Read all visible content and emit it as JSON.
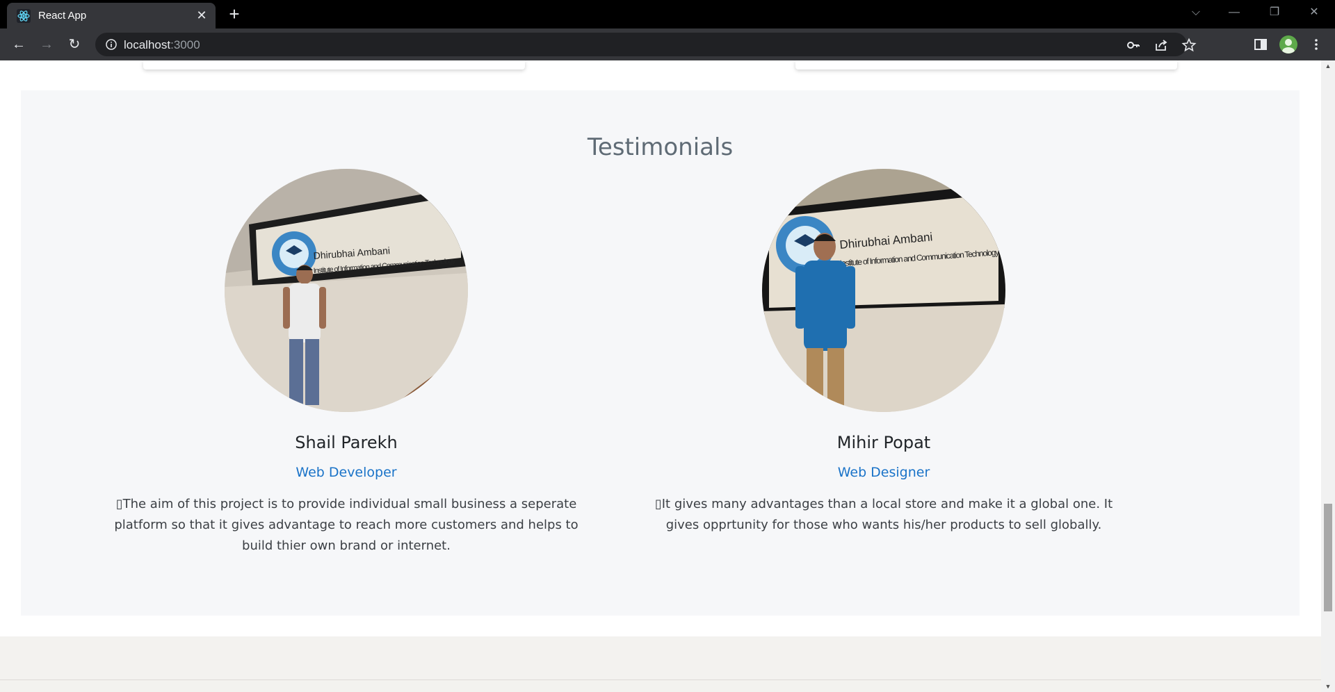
{
  "browser": {
    "tab_title": "React App",
    "tab_close": "✕",
    "new_tab": "+",
    "url_host": "localhost",
    "url_port": ":3000",
    "window_controls": {
      "tabs_menu": "⌵",
      "minimize": "—",
      "restore": "❐",
      "close": "✕"
    },
    "nav": {
      "back": "←",
      "forward": "→",
      "reload": "↻"
    },
    "icons": {
      "favicon": "react-icon",
      "info": "info-icon",
      "key": "key-icon",
      "share": "share-icon",
      "star": "star-icon",
      "sidepanel": "side-panel-icon",
      "profile": "profile-avatar",
      "menu": "more-vert-icon"
    }
  },
  "testimonials": {
    "title": "Testimonials",
    "people": [
      {
        "name": "Shail Parekh",
        "role": "Web Developer",
        "quote": "The aim of this project is to provide individual small business a seperate platform so that it gives advantage to reach more customers and helps to build thier own brand or internet.",
        "quote_prefix": "▯",
        "photo_sign_line1": "Dhirubhai Ambani",
        "photo_sign_line2": "Institute of Information and Communication Technology",
        "shirt_color": "#e9e9e9"
      },
      {
        "name": "Mihir Popat",
        "role": "Web Designer",
        "quote": "It gives many advantages than a local store and make it a global one. It gives opprtunity for those who wants his/her products to sell globally.",
        "quote_prefix": "▯",
        "photo_sign_line1": "Dhirubhai Ambani",
        "photo_sign_line2": "Institute of Information and Communication Technology",
        "shirt_color": "#1f6fb0"
      }
    ]
  },
  "colors": {
    "section_bg": "#f6f7f9",
    "role_color": "#1a73c8",
    "title_color": "#5f6b75",
    "footer_bg": "#f3f2ef"
  },
  "scrollbar": {
    "up": "▲",
    "down": "▼"
  }
}
